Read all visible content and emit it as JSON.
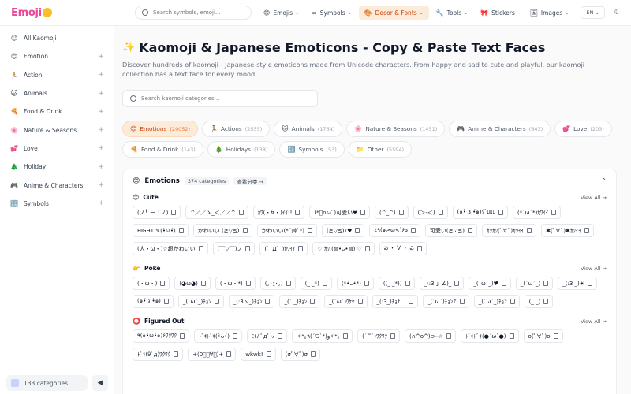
{
  "logo": {
    "text": "Emoji"
  },
  "sidebar": {
    "items": [
      {
        "label": "All Kaomoji",
        "icon": "☺",
        "plus": ""
      },
      {
        "label": "Emotion",
        "icon": "😊",
        "plus": "+"
      },
      {
        "label": "Action",
        "icon": "🏃",
        "plus": "+"
      },
      {
        "label": "Animals",
        "icon": "🐱",
        "plus": "+"
      },
      {
        "label": "Food & Drink",
        "icon": "🍕",
        "plus": "+"
      },
      {
        "label": "Nature & Seasons",
        "icon": "🌸",
        "plus": "+"
      },
      {
        "label": "Love",
        "icon": "💕",
        "plus": "+"
      },
      {
        "label": "Holiday",
        "icon": "🎄",
        "plus": "+"
      },
      {
        "label": "Anime & Characters",
        "icon": "🎮",
        "plus": "+"
      },
      {
        "label": "Symbols",
        "icon": "🔣",
        "plus": "+"
      }
    ],
    "footer_count": "133 categories",
    "collapse_glyph": "◀"
  },
  "topbar": {
    "search_placeholder": "Search symbols, emoji...",
    "nav": [
      {
        "label": "Emojis",
        "icon": "😊",
        "chev": "⌄",
        "active": false
      },
      {
        "label": "Symbols",
        "icon": "∞",
        "chev": "⌄",
        "active": false
      },
      {
        "label": "Decor & Fonts",
        "icon": "🎨",
        "chev": "⌄",
        "active": true
      },
      {
        "label": "Tools",
        "icon": "🔧",
        "chev": "⌄",
        "active": false
      },
      {
        "label": "Stickers",
        "icon": "🎀",
        "chev": "",
        "active": false
      },
      {
        "label": "Images",
        "icon": "🖼",
        "chev": "⌄",
        "active": false
      }
    ],
    "lang": "EN ⌄",
    "theme_glyph": "☾"
  },
  "main": {
    "title_icon": "✨",
    "title": "Kaomoji & Japanese Emoticons - Copy & Paste Text Faces",
    "description": "Discover hundreds of kaomoji - Japanese-style emoticons made from Unicode characters. From happy and sad to cute and playful, our kaomoji collection has a text face for every mood.",
    "category_search_placeholder": "Search kaomoji categories...",
    "pills": [
      {
        "label": "Emotions",
        "count": "(29052)",
        "icon": "😊",
        "active": true
      },
      {
        "label": "Actions",
        "count": "(2555)",
        "icon": "🏃",
        "active": false
      },
      {
        "label": "Animals",
        "count": "(1764)",
        "icon": "🐱",
        "active": false
      },
      {
        "label": "Nature & Seasons",
        "count": "(1451)",
        "icon": "🌸",
        "active": false
      },
      {
        "label": "Anime & Characters",
        "count": "(643)",
        "icon": "🎮",
        "active": false
      },
      {
        "label": "Love",
        "count": "(203)",
        "icon": "💕",
        "active": false
      },
      {
        "label": "Food & Drink",
        "count": "(143)",
        "icon": "🍕",
        "active": false
      },
      {
        "label": "Holidays",
        "count": "(138)",
        "icon": "🎄",
        "active": false
      },
      {
        "label": "Symbols",
        "count": "(53)",
        "icon": "🔣",
        "active": false
      },
      {
        "label": "Other",
        "count": "(5594)",
        "icon": "📁",
        "active": false
      }
    ],
    "panel": {
      "icon": "😊",
      "title": "Emotions",
      "count": "374 categories",
      "link": "查看分类 →",
      "collapse_glyph": "⌃",
      "sections": [
        {
          "title": "Cute",
          "icon": "😊",
          "view_all": "View All →",
          "chips": [
            "(ノ╹ ー ╹ノ)",
            "^／／ゝ_＜／／^",
            "ｶﾜ(・∀・)ｲｲ!!",
            "(*ﾟ∩ωﾟ)可愛い❤",
            "(^_^)",
            "(＞-＜)",
            "(๑•̀ з •́๑)ｸﾞﾛﾛﾛ",
            "(*´ω`*)ｶﾜｲｲ",
            "FIGHT ✎(•̀ω•́)",
            "かわいい (≧▽≦)",
            "かわいい(*´艸`*)",
            "(≧▽≦)ﾉ♥",
            "ε٩(๑>ω<)۶з",
            "可愛い(≧ω≦)",
            "ｶﾜｶﾜ(ﾟ∀ﾟ)ｶﾜｲｲ",
            "✱(ﾟ∀ﾟ)✱ｶﾜｲｲ",
            "(人・ω・)☆超かわいい",
            "(￣▽￣)ノ",
            "(゜Д゜)ｶﾜｲｲ",
            "♡ ｶﾜ (◍•ᴗ•◍) ♡",
            "ఎ ・ ∀ ・ ఎ"
          ]
        },
        {
          "title": "Poke",
          "icon": "👉",
          "view_all": "View All →",
          "chips": [
            "(・ω・)",
            "(◕ω◕)",
            "(・ω・*)",
            "(｡･ｪ･｡)",
            "(_ _*)",
            "(*•̀ᴗ•́*)",
            "((_ _*))",
            "_(:3 」∠)_",
            "_(´ω`_)♥",
            "_(´ω`_)",
            "_(:3 _)☀",
            "(๑•́ ₃ •̀๑)",
            "_(´ω`_)ﾁｮﾝ",
            "_(:3ヽ_)ﾁｮﾝ",
            "_(´ _)ﾁｮﾝ",
            "_(´ω`)ｳｹｹ",
            "_(:3_)ﾁｮﾅ...",
            "_(´ω`)ﾁｮﾝ♪",
            "_(´ω`_)ﾁｮﾝ",
            "(_ _)"
          ]
        },
        {
          "title": "Figured Out",
          "icon": "⭕",
          "view_all": "View All →",
          "chips": [
            "٩(๑•̀ω•́๑)۶ﾜｸﾜｸ",
            "ﾄﾞｷﾄﾞｷ(•̀ᴗ•́)",
            "ﾐ(ﾉ ﾟдﾟ)ﾉ",
            "✧*｡٩(ˊᗜˋ*)و✧*｡",
            "(˙꒳˙)ﾜｸﾜｸ",
            "(∩^o^)⊃━☆",
            "ﾄﾞｷﾄﾞｷ(●´ω`●)",
            "o(ﾟ∀ﾟ)o",
            "ﾄﾞｷ(9ﾟд)ﾜｸﾜｸ",
            "+(0ﾟ･∀･)+",
            "wkwk!",
            "(σﾟ∀ﾟ)σ"
          ]
        }
      ]
    }
  }
}
